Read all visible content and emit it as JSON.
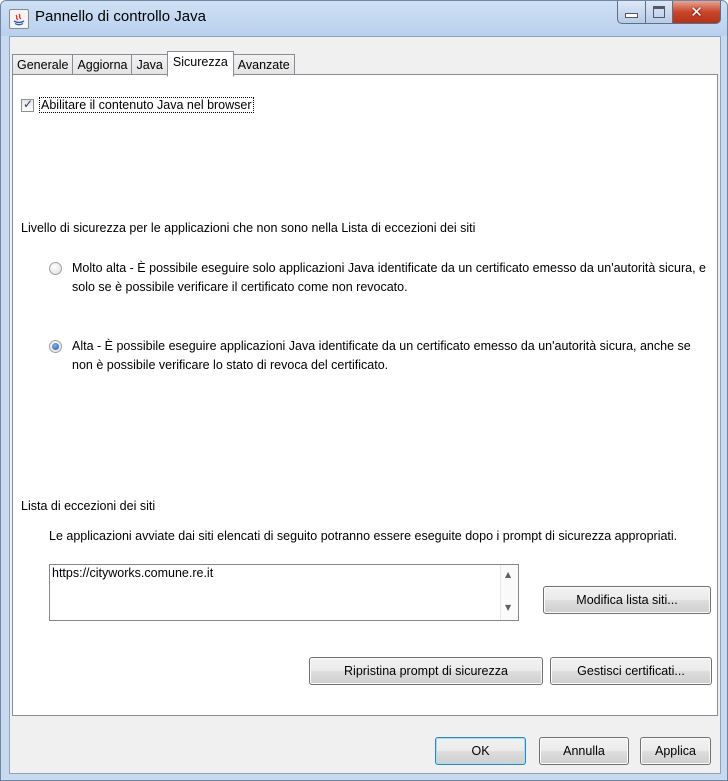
{
  "window": {
    "title": "Pannello di controllo Java"
  },
  "tabs": [
    "Generale",
    "Aggiorna",
    "Java",
    "Sicurezza",
    "Avanzate"
  ],
  "active_tab": "Sicurezza",
  "security": {
    "enable_checkbox_label": "Abilitare il contenuto Java nel browser",
    "enable_checked": true,
    "level_label": "Livello di sicurezza per le applicazioni che non sono nella Lista di eccezioni dei siti",
    "options": [
      {
        "label": "Molto alta - È possibile eseguire solo applicazioni Java identificate da un certificato emesso da un'autorità sicura, e solo se è possibile verificare il certificato come non revocato.",
        "selected": false
      },
      {
        "label": "Alta - È possibile eseguire applicazioni Java identificate da un certificato emesso da un'autorità sicura, anche se non è possibile verificare lo stato di revoca del certificato.",
        "selected": true
      }
    ],
    "exceptions_title": "Lista di eccezioni dei siti",
    "exceptions_desc": "Le applicazioni avviate dai siti elencati di seguito potranno essere eseguite dopo i prompt di sicurezza appropriati.",
    "site": "https://cityworks.comune.re.it",
    "edit_sites_button": "Modifica lista siti...",
    "restore_prompts_button": "Ripristina prompt di sicurezza",
    "manage_certs_button": "Gestisci certificati..."
  },
  "footer": {
    "ok": "OK",
    "cancel": "Annulla",
    "apply": "Applica"
  },
  "colors": {
    "titlebar": "#c9daf0",
    "close_button": "#c8452a",
    "default_button_border": "#3c7fb1"
  },
  "icons": [
    "java-icon",
    "minimize-icon",
    "maximize-icon",
    "close-icon",
    "scroll-up-icon",
    "scroll-down-icon"
  ]
}
